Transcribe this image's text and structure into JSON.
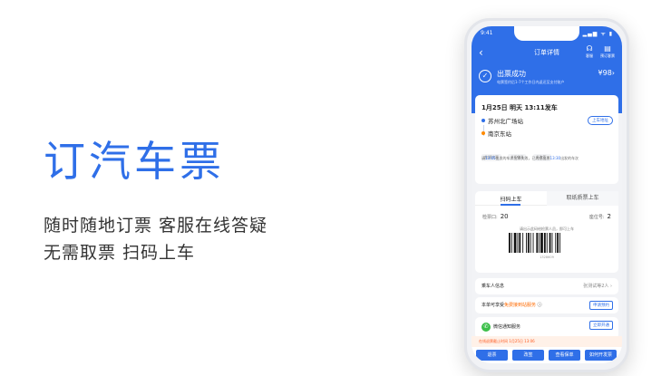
{
  "hero": {
    "title": "订汽车票",
    "line1": "随时随地订票  客服在线答疑",
    "line2": "无需取票  扫码上车"
  },
  "phone": {
    "statusbar": {
      "time": "9:41",
      "signal": "▂▄▆ ᯤ ▮"
    },
    "nav": {
      "back": "‹",
      "title": "订单详情",
      "service_icon": "headset-icon",
      "service_label": "客服",
      "rebook_icon": "document-icon",
      "rebook_label": "预订客票"
    },
    "status": {
      "title": "出票成功",
      "price": "¥98",
      "price_arrow": "›",
      "subtitle": "电票签约后1-7个工作日内返还至支付账户"
    },
    "trip": {
      "date_line": "1月25日  明天  13:11发车",
      "from": "苏州北广场站",
      "to": "南京东站",
      "route_button": "上车地址",
      "chips": [
        "普通快客",
        "#XXXX",
        "退改签 ›"
      ],
      "notice_prefix": "请",
      "notice_highlight": "13:05",
      "notice_middle": "出发的车次出票失败，已为您出票",
      "notice_highlight2": "13:30",
      "notice_suffix": "出发的车次"
    },
    "ticket": {
      "tab_scan": "扫码上车",
      "tab_pickup": "取纸质票上车",
      "gate_label": "检票口:",
      "gate_value": "20",
      "seat_label": "座位号:",
      "seat_value": "2",
      "hint": "请出示此码给检票人员，即可上车",
      "barcode_number": "1328609"
    },
    "passenger": {
      "label": "乘车人信息",
      "value": "张测试等2人 ›"
    },
    "service": {
      "prefix": "本单可享受",
      "highlight": "免费接到站服务",
      "info_icon": "info-icon",
      "button": "申请预约"
    },
    "wechat": {
      "icon": "wechat-icon",
      "label": "微信通知服务",
      "button": "立即开通"
    },
    "deadline": "在线退票截止时间 1月25日 13:06",
    "actions": [
      "退票",
      "改签",
      "查看保单",
      "如何开发票"
    ]
  },
  "colors": {
    "brand_blue": "#2f6fe8",
    "warning_orange": "#ff5a1f",
    "success_green": "#3cbf4a"
  }
}
